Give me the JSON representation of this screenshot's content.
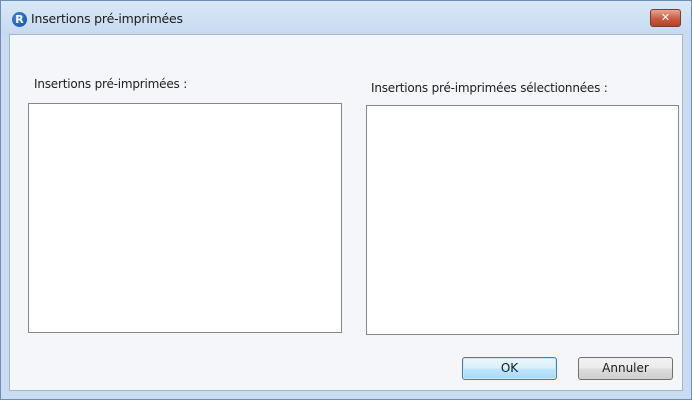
{
  "window": {
    "title": "Insertions pré-imprimées",
    "app_icon_letter": "R"
  },
  "dialog": {
    "left_list_label": "Insertions pré-imprimées :",
    "right_list_label": "Insertions pré-imprimées sélectionnées :",
    "left_list_items": [],
    "right_list_items": []
  },
  "buttons": {
    "ok_label": "OK",
    "cancel_label": "Annuler"
  },
  "colors": {
    "title_bar": "#c7daf0",
    "close_button": "#c75b43",
    "default_button_border": "#3c7fb1"
  }
}
